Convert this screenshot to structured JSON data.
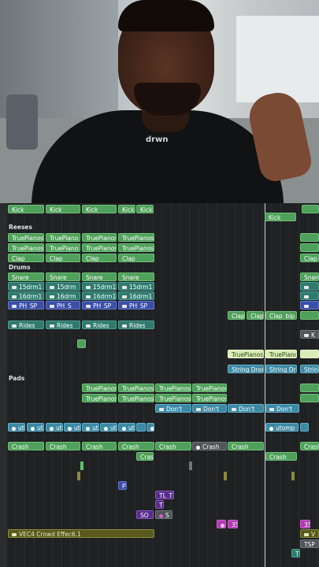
{
  "tracks": {
    "reeses": "Reeses",
    "drums": "Drums",
    "pads": "Pads"
  },
  "clips": {
    "kick": "Kick",
    "truepianos": "TruePianos",
    "truepiano": "TruePiano",
    "clap": "Clap",
    "snare": "Snare",
    "drm15": "15drm1",
    "drm15b": "15drm",
    "drm16": "16drm1",
    "drm16b": "16drm",
    "phsp": "PH_SP",
    "phs": "PH_S",
    "rides": "Rides",
    "clapbip": "Clap_bip_",
    "k": "K",
    "stringdron": "String Dron",
    "stringdr": "String Dr",
    "string": "String",
    "dont": "Don't",
    "ut": "ut",
    "utomp": "utomp",
    "crash": "Crash",
    "p": "P",
    "tlt": "TL_T",
    "t": "T",
    "so": "SO_",
    "s": "S",
    "n35": "35",
    "vec4": "VEC4 Crowd Effec6.1",
    "v": "V",
    "tsp": "TSP_"
  },
  "video": {
    "collar_text": "drwn"
  }
}
